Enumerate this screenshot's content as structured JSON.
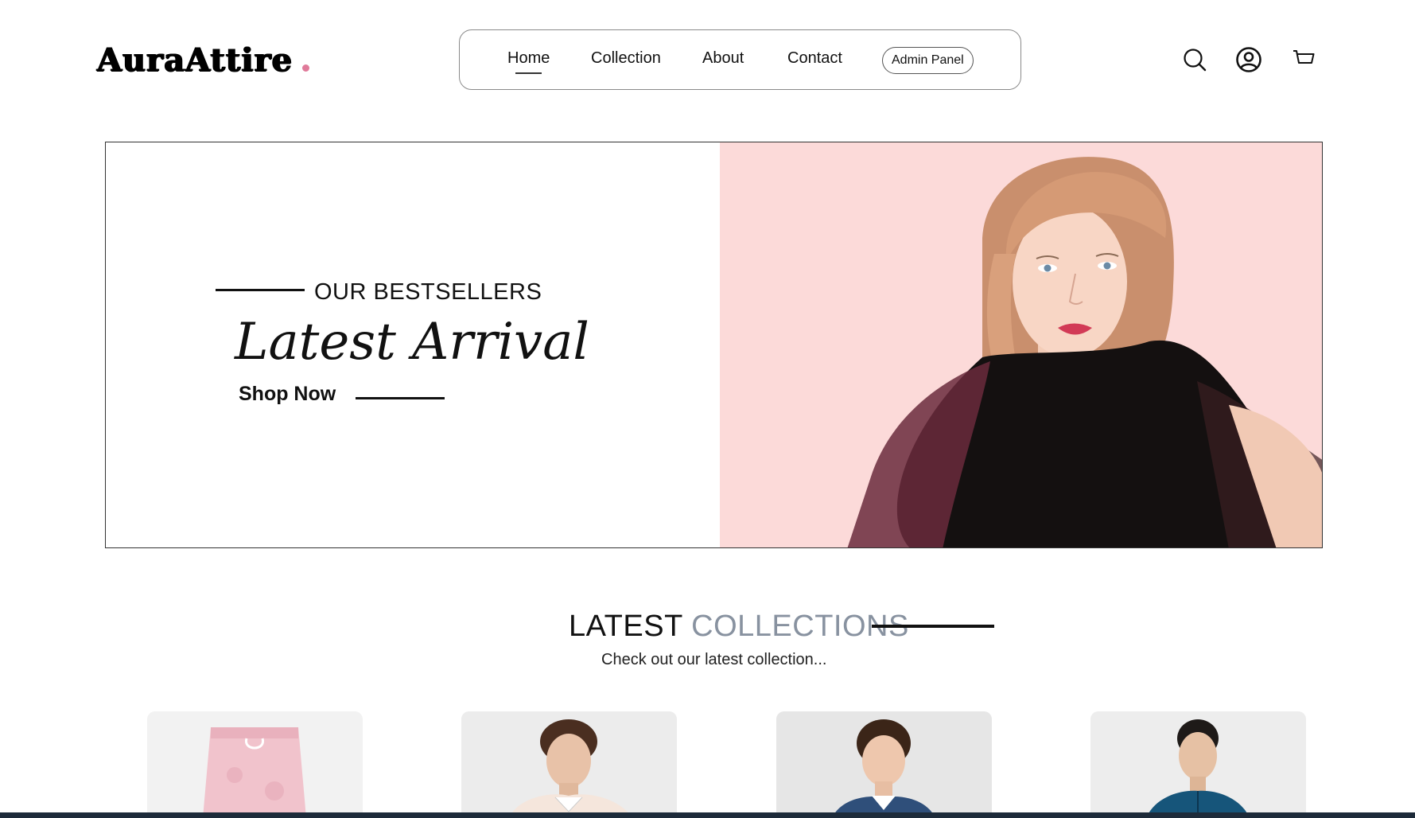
{
  "brand": {
    "name": "AuraAttire",
    "dot_color": "#e07a9a"
  },
  "nav": {
    "items": [
      {
        "label": "Home",
        "active": true
      },
      {
        "label": "Collection",
        "active": false
      },
      {
        "label": "About",
        "active": false
      },
      {
        "label": "Contact",
        "active": false
      }
    ],
    "admin_label": "Admin Panel"
  },
  "header_icons": [
    "search-icon",
    "user-profile-icon",
    "cart-icon"
  ],
  "hero": {
    "eyebrow": "OUR BESTSELLERS",
    "title": "Latest Arrival",
    "cta": "Shop Now",
    "image_bg": "#fcdad9"
  },
  "latest": {
    "title_dark": "LATEST",
    "title_light": "COLLECTIONS",
    "subtitle": "Check out our latest collection...",
    "products": [
      {
        "image": "pink-pants"
      },
      {
        "image": "man-cream-polo"
      },
      {
        "image": "boy-denim-shirt"
      },
      {
        "image": "woman-teal-jacket"
      }
    ]
  },
  "colors": {
    "accent_gray": "#8892a0",
    "footer_bar": "#1d2b3a"
  }
}
